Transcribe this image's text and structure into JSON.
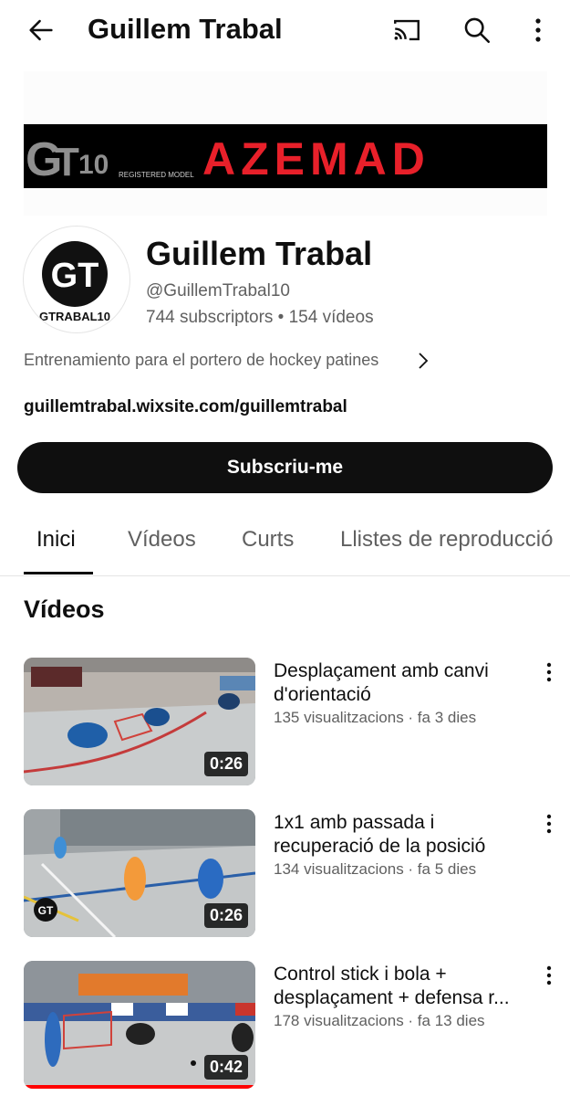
{
  "topbar": {
    "title": "Guillem Trabal",
    "icons": [
      "back-arrow-icon",
      "cast-icon",
      "search-icon",
      "more-vert-icon"
    ]
  },
  "banner": {
    "logo_text": "GT10",
    "logo_subtext": "REGISTERED MODEL",
    "brand_text": "AZEMAD",
    "colors": {
      "brand": "#e8202a",
      "background": "#000000"
    }
  },
  "channel": {
    "avatar_text": "GT",
    "avatar_caption": "GTRABAL10",
    "name": "Guillem Trabal",
    "handle": "@GuillemTrabal10",
    "stats": "744 subscriptors • 154 vídeos",
    "description": "Entrenamiento para el portero de hockey patines",
    "link": "guillemtrabal.wixsite.com/guillemtrabal",
    "subscribe_label": "Subscriu-me"
  },
  "tabs": [
    {
      "label": "Inici",
      "active": true
    },
    {
      "label": "Vídeos",
      "active": false
    },
    {
      "label": "Curts",
      "active": false
    },
    {
      "label": "Llistes de reproducció",
      "active": false
    }
  ],
  "section": {
    "title": "Vídeos"
  },
  "videos": [
    {
      "title": "Desplaçament amb canvi d'orientació",
      "meta": "135 visualitzacions · fa 3 dies",
      "duration": "0:26"
    },
    {
      "title": "1x1 amb passada i recuperació de la posició",
      "meta": "134 visualitzacions · fa 5 dies",
      "duration": "0:26",
      "thumb_logo": "GT"
    },
    {
      "title": "Control stick i bola + desplaçament + defensa r...",
      "meta": "178 visualitzacions · fa 13 dies",
      "duration": "0:42"
    }
  ]
}
